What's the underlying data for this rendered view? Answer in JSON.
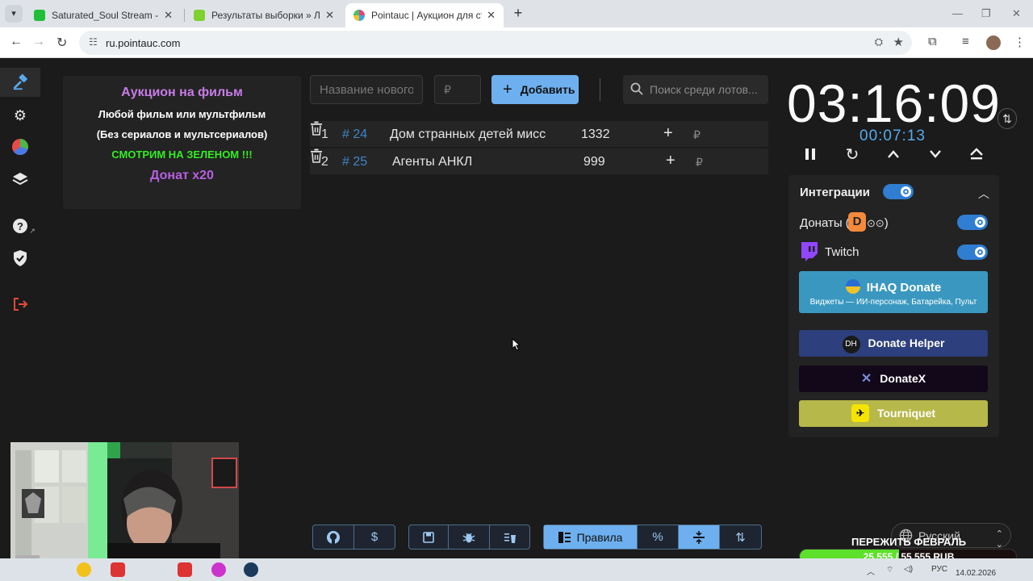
{
  "browser": {
    "tabs": [
      {
        "label": "Saturated_Soul Stream - Watch",
        "active": false,
        "favicon_color": "#1fbf3a"
      },
      {
        "label": "Результаты выборки » Лордфи",
        "active": false,
        "favicon_color": "#7ed12e"
      },
      {
        "label": "Pointauc | Аукцион для стриме",
        "active": true,
        "favicon_color": "#e0457b"
      }
    ],
    "url": "ru.pointauc.com"
  },
  "lot_info": {
    "line1": "Аукцион на фильм",
    "line2": "Любой фильм или мультфильм",
    "line3": "(Без сериалов и мультсериалов)",
    "line4": "СМОТРИМ НА ЗЕЛЕНОМ !!!",
    "line5": "Донат x20"
  },
  "add_form": {
    "name_placeholder": "Название нового лота",
    "amount_placeholder": "₽",
    "add_label": "Добавить",
    "search_placeholder": "Поиск среди лотов..."
  },
  "lots": [
    {
      "index": "1",
      "id": "# 24",
      "name": "Дом странных детей мисс",
      "amount": "1332",
      "currency": "₽"
    },
    {
      "index": "2",
      "id": "# 25",
      "name": "Агенты АНКЛ",
      "amount": "999",
      "currency": "₽"
    }
  ],
  "timer": {
    "main": "03:16:09",
    "sub": "00:07:13"
  },
  "integrations": {
    "title": "Интеграции",
    "donations_label": "Донаты (",
    "donations_suffix": ")",
    "donations_logo": "D",
    "twitch_label": "Twitch",
    "ihaq_title": "IHAQ Donate",
    "ihaq_subtitle": "Виджеты — ИИ-персонаж, Батарейка, Пульт",
    "donate_helper_logo": "DH",
    "donate_helper": "Donate Helper",
    "donatex": "DonateX",
    "tourniquet": "Tourniquet"
  },
  "bottom_toolbar": {
    "rules_label": "Правила",
    "percent_label": "%"
  },
  "language": "Русский",
  "goal": {
    "title": "ПЕРЕЖИТЬ ФЕВРАЛЬ",
    "text": "25 555 / 55 555 RUB",
    "progress": 0.46
  },
  "taskbar": {
    "lang": "РУС",
    "date": "14.02.2026"
  },
  "colors": {
    "accent": "#6eb0ef",
    "toggle_on": "#2f7ed1",
    "lot_hash": "#3f86c9",
    "green_text": "#33ee22",
    "purple_text": "#c77ce6"
  }
}
